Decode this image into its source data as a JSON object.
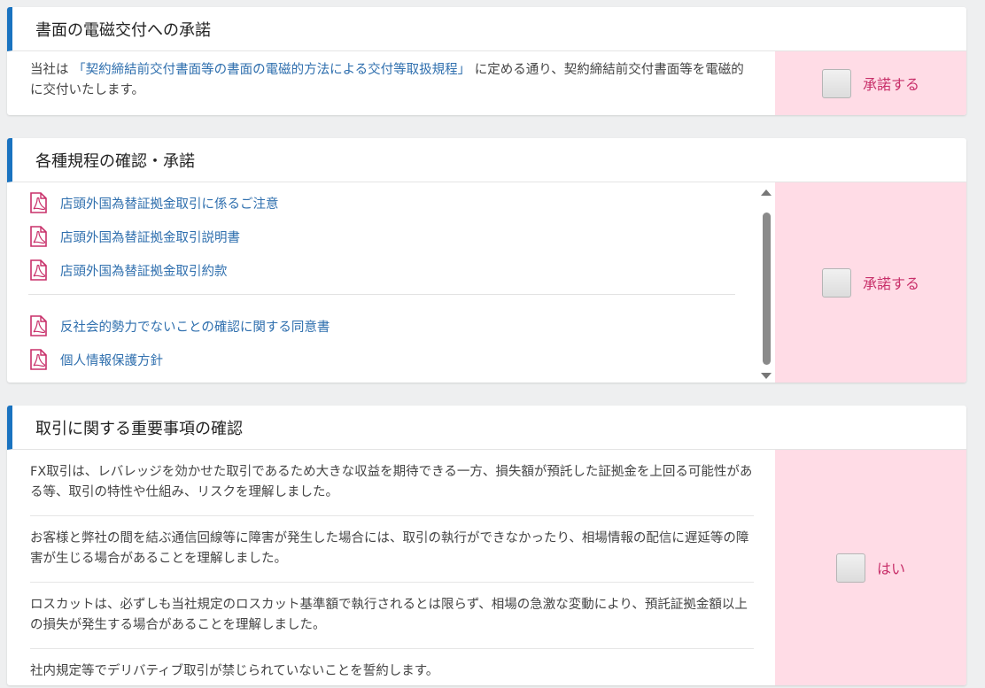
{
  "sections": {
    "electronic": {
      "title": "書面の電磁交付への承諾",
      "text_prefix": "当社は",
      "link": "「契約締結前交付書面等の書面の電磁的方法による交付等取扱規程」",
      "text_suffix": "に定める通り、契約締結前交付書面等を電磁的に交付いたします。",
      "accept_label": "承諾する"
    },
    "regulations": {
      "title": "各種規程の確認・承諾",
      "documents_group1": [
        "店頭外国為替証拠金取引に係るご注意",
        "店頭外国為替証拠金取引説明書",
        "店頭外国為替証拠金取引約款"
      ],
      "documents_group2": [
        "反社会的勢力でないことの確認に関する同意書",
        "個人情報保護方針"
      ],
      "accept_label": "承諾する"
    },
    "important": {
      "title": "取引に関する重要事項の確認",
      "notices": [
        "FX取引は、レバレッジを効かせた取引であるため大きな収益を期待できる一方、損失額が預託した証拠金を上回る可能性がある等、取引の特性や仕組み、リスクを理解しました。",
        "お客様と弊社の間を結ぶ通信回線等に障害が発生した場合には、取引の執行ができなかったり、相場情報の配信に遅延等の障害が生じる場合があることを理解しました。",
        "ロスカットは、必ずしも当社規定のロスカット基準額で執行されるとは限らず、相場の急激な変動により、預託証拠金額以上の損失が発生する場合があることを理解しました。",
        "社内規定等でデリバティブ取引が禁じられていないことを誓約します。"
      ],
      "accept_label": "はい"
    }
  },
  "icons": {
    "document": "pdf-icon"
  },
  "colors": {
    "accent": "#1a73c0",
    "link": "#2f6fae",
    "accept_bg": "#ffdce6",
    "accept_text": "#c8306a",
    "pdf_icon": "#c8306a"
  }
}
